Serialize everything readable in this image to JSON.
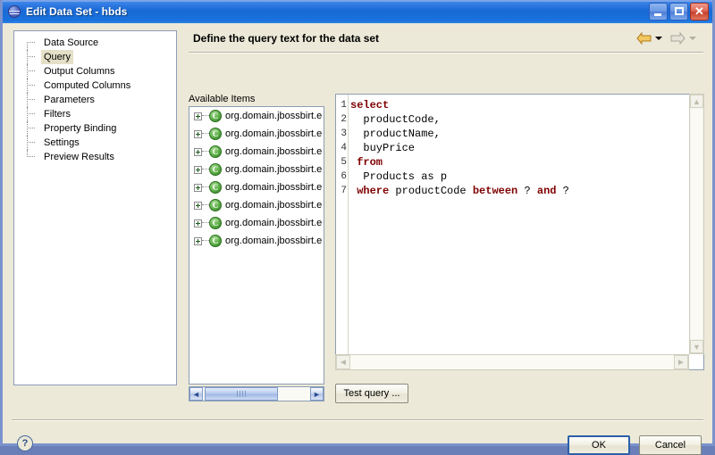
{
  "window": {
    "title": "Edit Data Set - hbds",
    "icon": "birt-sphere-icon",
    "minimize_label": "",
    "maximize_label": "",
    "close_label": "✕"
  },
  "sidebar": {
    "items": [
      {
        "label": "Data Source",
        "selected": false
      },
      {
        "label": "Query",
        "selected": true
      },
      {
        "label": "Output Columns",
        "selected": false
      },
      {
        "label": "Computed Columns",
        "selected": false
      },
      {
        "label": "Parameters",
        "selected": false
      },
      {
        "label": "Filters",
        "selected": false
      },
      {
        "label": "Property Binding",
        "selected": false
      },
      {
        "label": "Settings",
        "selected": false
      },
      {
        "label": "Preview Results",
        "selected": false
      }
    ]
  },
  "header": {
    "title": "Define the query text for the data set",
    "back_arrow": "back-arrow",
    "forward_arrow": "forward-arrow"
  },
  "available_items": {
    "label": "Available Items",
    "rows": [
      {
        "icon_letter": "C",
        "text": "org.domain.jbossbirt.e"
      },
      {
        "icon_letter": "C",
        "text": "org.domain.jbossbirt.e"
      },
      {
        "icon_letter": "C",
        "text": "org.domain.jbossbirt.e"
      },
      {
        "icon_letter": "C",
        "text": "org.domain.jbossbirt.e"
      },
      {
        "icon_letter": "C",
        "text": "org.domain.jbossbirt.e"
      },
      {
        "icon_letter": "C",
        "text": "org.domain.jbossbirt.e"
      },
      {
        "icon_letter": "C",
        "text": "org.domain.jbossbirt.e"
      },
      {
        "icon_letter": "C",
        "text": "org.domain.jbossbirt.e"
      }
    ],
    "scroll_left": "◄",
    "scroll_right": "►"
  },
  "editor": {
    "line_numbers": [
      "1",
      "2",
      "3",
      "4",
      "5",
      "6",
      "7"
    ],
    "lines": [
      [
        {
          "t": "select",
          "kw": true
        }
      ],
      [
        {
          "t": "  productCode,",
          "kw": false
        }
      ],
      [
        {
          "t": "  productName,",
          "kw": false
        }
      ],
      [
        {
          "t": "  buyPrice",
          "kw": false
        }
      ],
      [
        {
          "t": " from",
          "kw": true
        }
      ],
      [
        {
          "t": "  Products as p",
          "kw": false
        }
      ],
      [
        {
          "t": " where",
          "kw": true
        },
        {
          "t": " productCode ",
          "kw": false
        },
        {
          "t": "between",
          "kw": true
        },
        {
          "t": " ? ",
          "kw": false
        },
        {
          "t": "and",
          "kw": true
        },
        {
          "t": " ?",
          "kw": false
        }
      ]
    ],
    "scroll_up": "▲",
    "scroll_down": "▼",
    "scroll_left": "◄",
    "scroll_right": "►"
  },
  "buttons": {
    "test_query": "Test query ...",
    "ok": "OK",
    "cancel": "Cancel",
    "help": "?"
  }
}
